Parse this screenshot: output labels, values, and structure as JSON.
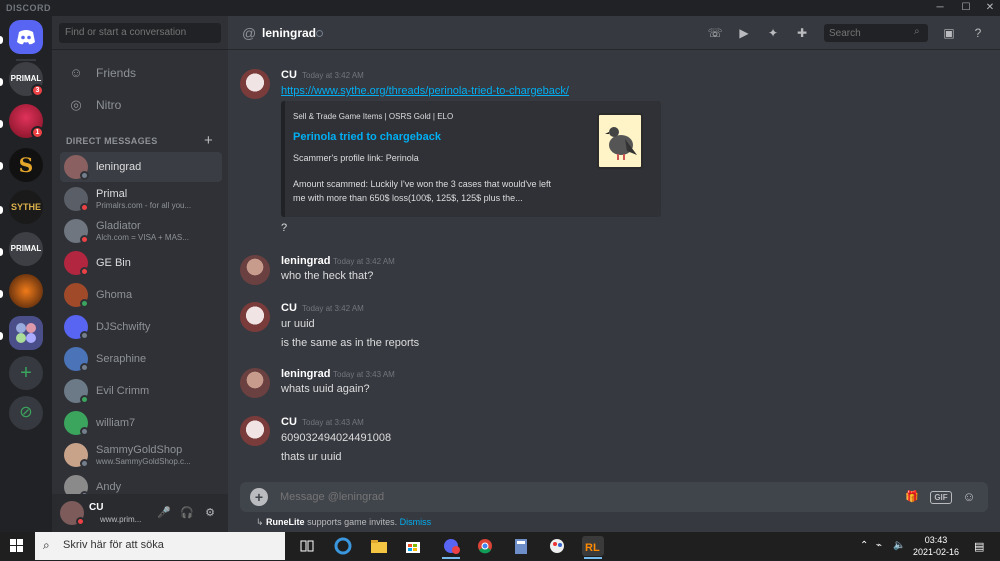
{
  "window": {
    "brand": "DISCORD",
    "minimize": "─",
    "maximize": "☐",
    "close": "✕"
  },
  "servers": [
    {
      "name": "home",
      "label": ""
    },
    {
      "name": "primal",
      "label": "PRIMAL",
      "badge": "3"
    },
    {
      "name": "ge-bin",
      "label": "",
      "badge": "1"
    },
    {
      "name": "s-server",
      "label": "S"
    },
    {
      "name": "sythe",
      "label": "SYTHE"
    },
    {
      "name": "primal-services",
      "label": "PRIMAL"
    },
    {
      "name": "server-7",
      "label": ""
    },
    {
      "name": "server-8",
      "label": ""
    }
  ],
  "sidebar": {
    "search_placeholder": "Find or start a conversation",
    "friends": "Friends",
    "nitro": "Nitro",
    "dm_header": "DIRECT MESSAGES",
    "dm_add": "+",
    "dms": [
      {
        "name": "leningrad",
        "sub": "",
        "status": "offline",
        "color": "#8a6060",
        "active": true
      },
      {
        "name": "Primal",
        "sub": "Primalrs.com - for all you...",
        "status": "dnd",
        "color": "#5a5e66",
        "bright": true
      },
      {
        "name": "Gladiator",
        "sub": "Alch.com = VISA + MAS...",
        "status": "dnd",
        "color": "#6f7680"
      },
      {
        "name": "GE Bin",
        "sub": "",
        "status": "dnd",
        "color": "#b3263f",
        "bright": true
      },
      {
        "name": "Ghoma",
        "sub": "",
        "status": "online",
        "color": "#a04a2a"
      },
      {
        "name": "DJSchwifty",
        "sub": "",
        "status": "offline",
        "color": "#5865f2"
      },
      {
        "name": "Seraphine",
        "sub": "",
        "status": "offline",
        "color": "#4a73b8"
      },
      {
        "name": "Evil Crimm",
        "sub": "",
        "status": "online",
        "color": "#6b7a86"
      },
      {
        "name": "william7",
        "sub": "",
        "status": "offline",
        "color": "#3ba55d"
      },
      {
        "name": "SammyGoldShop",
        "sub": "www.SammyGoldShop.c...",
        "status": "offline",
        "color": "#c9a28a"
      },
      {
        "name": "Andy",
        "sub": "",
        "status": "offline",
        "color": "#8a8a8a"
      }
    ]
  },
  "user": {
    "name": "CU",
    "status_text": "www.prim...",
    "mute": "🎤",
    "headset": "🎧",
    "settings": "⚙"
  },
  "channel": {
    "name": "leningrad",
    "search_placeholder": "Search"
  },
  "messages": [
    {
      "author": "CU",
      "time": "Today at 3:42 AM",
      "link": "https://www.sythe.org/threads/perinola-tried-to-chargeback/",
      "embed": {
        "provider": "Sell & Trade Game Items | OSRS Gold | ELO",
        "title": "Perinola tried to chargeback",
        "line1": "Scammer's profile link: Perinola",
        "line2": "Amount scammed: Luckily I've won the 3 cases that would've left",
        "line3": "me with more than 650$ loss(100$, 125$, 125$ plus the..."
      },
      "after": "?"
    },
    {
      "author": "leningrad",
      "time": "Today at 3:42 AM",
      "lines": [
        "who the heck that?"
      ]
    },
    {
      "author": "CU",
      "time": "Today at 3:42 AM",
      "lines": [
        "ur uuid",
        "is the same as in the reports"
      ]
    },
    {
      "author": "leningrad",
      "time": "Today at 3:43 AM",
      "lines": [
        "whats uuid again?"
      ]
    },
    {
      "author": "CU",
      "time": "Today at 3:43 AM",
      "lines": [
        "609032494024491008",
        "thats ur uuid"
      ]
    }
  ],
  "composer": {
    "placeholder": "Message @leningrad",
    "gif": "GIF"
  },
  "notice": {
    "app": "RuneLite",
    "text": " supports game invites. ",
    "dismiss": "Dismiss"
  },
  "taskbar": {
    "search_text": "Skriv här för att söka",
    "time": "03:43",
    "date": "2021-02-16"
  },
  "colors": {
    "accent": "#5865f2",
    "link": "#00aff4",
    "online": "#3ba55d",
    "dnd": "#ed4245",
    "offline": "#747f8d"
  }
}
